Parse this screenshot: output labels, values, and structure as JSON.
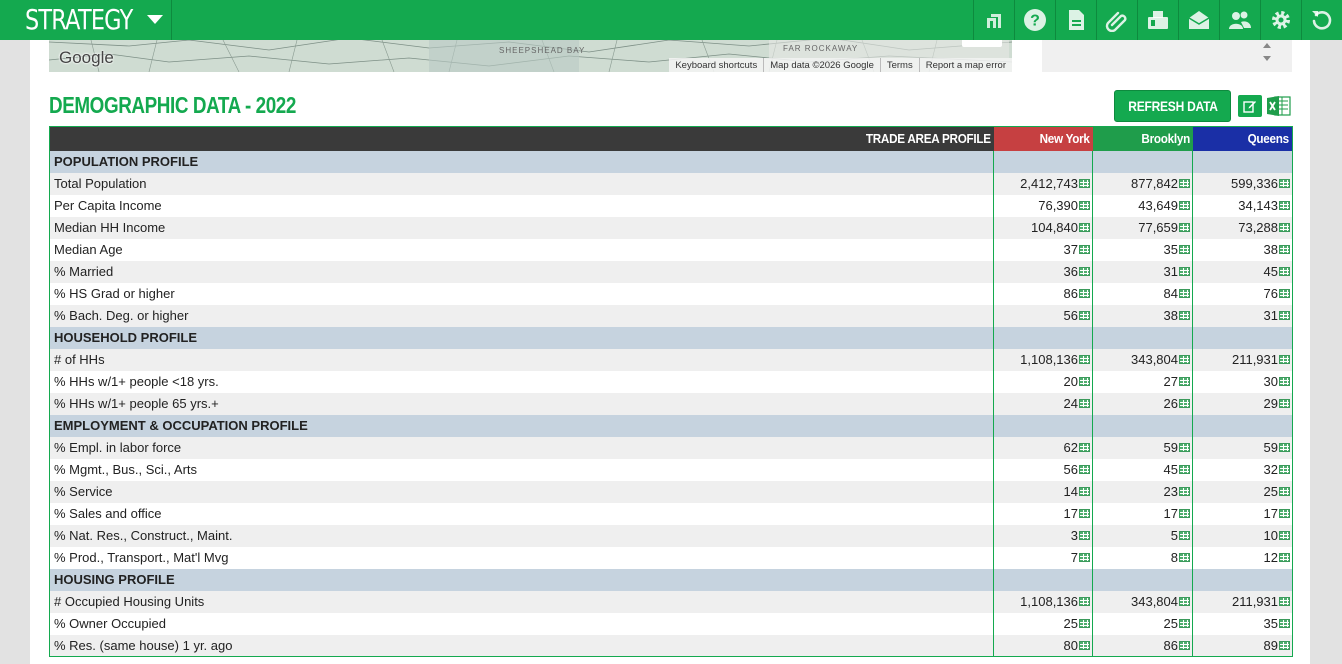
{
  "app": {
    "title": "STRATEGY"
  },
  "toolbar": {
    "icons": [
      "logo-icon",
      "help-icon",
      "report-icon",
      "attachment-icon",
      "fax-icon",
      "email-icon",
      "users-icon",
      "settings-icon",
      "refresh-icon"
    ]
  },
  "map": {
    "provider": "Google",
    "place_label_1": "SHEEPSHEAD BAY",
    "place_label_2": "FAR ROCKAWAY",
    "footer": [
      "Keyboard shortcuts",
      "Map data ©2026 Google",
      "Terms",
      "Report a map error"
    ]
  },
  "section": {
    "title": "DEMOGRAPHIC DATA - 2022",
    "refresh_label": "REFRESH DATA"
  },
  "colors": {
    "brand": "#14a94f",
    "new_york": "#c64041",
    "brooklyn": "#1f9d4b",
    "queens": "#1a2fa6",
    "section_row": "#c6d3df"
  },
  "table": {
    "header": "TRADE AREA PROFILE",
    "columns": [
      "New York",
      "Brooklyn",
      "Queens"
    ],
    "rows": [
      {
        "type": "section",
        "label": "POPULATION PROFILE"
      },
      {
        "type": "data",
        "label": "Total Population",
        "values": [
          "2,412,743",
          "877,842",
          "599,336"
        ]
      },
      {
        "type": "data",
        "label": "Per Capita Income",
        "values": [
          "76,390",
          "43,649",
          "34,143"
        ]
      },
      {
        "type": "data",
        "label": "Median HH Income",
        "values": [
          "104,840",
          "77,659",
          "73,288"
        ]
      },
      {
        "type": "data",
        "label": "Median Age",
        "values": [
          "37",
          "35",
          "38"
        ]
      },
      {
        "type": "data",
        "label": "% Married",
        "values": [
          "36",
          "31",
          "45"
        ]
      },
      {
        "type": "data",
        "label": "% HS Grad or higher",
        "values": [
          "86",
          "84",
          "76"
        ]
      },
      {
        "type": "data",
        "label": "% Bach. Deg. or higher",
        "values": [
          "56",
          "38",
          "31"
        ]
      },
      {
        "type": "section",
        "label": "HOUSEHOLD PROFILE"
      },
      {
        "type": "data",
        "label": "# of HHs",
        "values": [
          "1,108,136",
          "343,804",
          "211,931"
        ]
      },
      {
        "type": "data",
        "label": "% HHs w/1+ people <18 yrs.",
        "values": [
          "20",
          "27",
          "30"
        ]
      },
      {
        "type": "data",
        "label": "% HHs w/1+ people 65 yrs.+",
        "values": [
          "24",
          "26",
          "29"
        ]
      },
      {
        "type": "section",
        "label": "EMPLOYMENT & OCCUPATION PROFILE"
      },
      {
        "type": "data",
        "label": "% Empl. in labor force",
        "values": [
          "62",
          "59",
          "59"
        ]
      },
      {
        "type": "data",
        "label": "% Mgmt., Bus., Sci., Arts",
        "values": [
          "56",
          "45",
          "32"
        ]
      },
      {
        "type": "data",
        "label": "% Service",
        "values": [
          "14",
          "23",
          "25"
        ]
      },
      {
        "type": "data",
        "label": "% Sales and office",
        "values": [
          "17",
          "17",
          "17"
        ]
      },
      {
        "type": "data",
        "label": "% Nat. Res., Construct., Maint.",
        "values": [
          "3",
          "5",
          "10"
        ]
      },
      {
        "type": "data",
        "label": "% Prod., Transport., Mat'l Mvg",
        "values": [
          "7",
          "8",
          "12"
        ]
      },
      {
        "type": "section",
        "label": "HOUSING PROFILE"
      },
      {
        "type": "data",
        "label": "# Occupied Housing Units",
        "values": [
          "1,108,136",
          "343,804",
          "211,931"
        ]
      },
      {
        "type": "data",
        "label": "% Owner Occupied",
        "values": [
          "25",
          "25",
          "35"
        ]
      },
      {
        "type": "data",
        "label": "% Res. (same house) 1 yr. ago",
        "values": [
          "80",
          "86",
          "89"
        ]
      }
    ]
  }
}
